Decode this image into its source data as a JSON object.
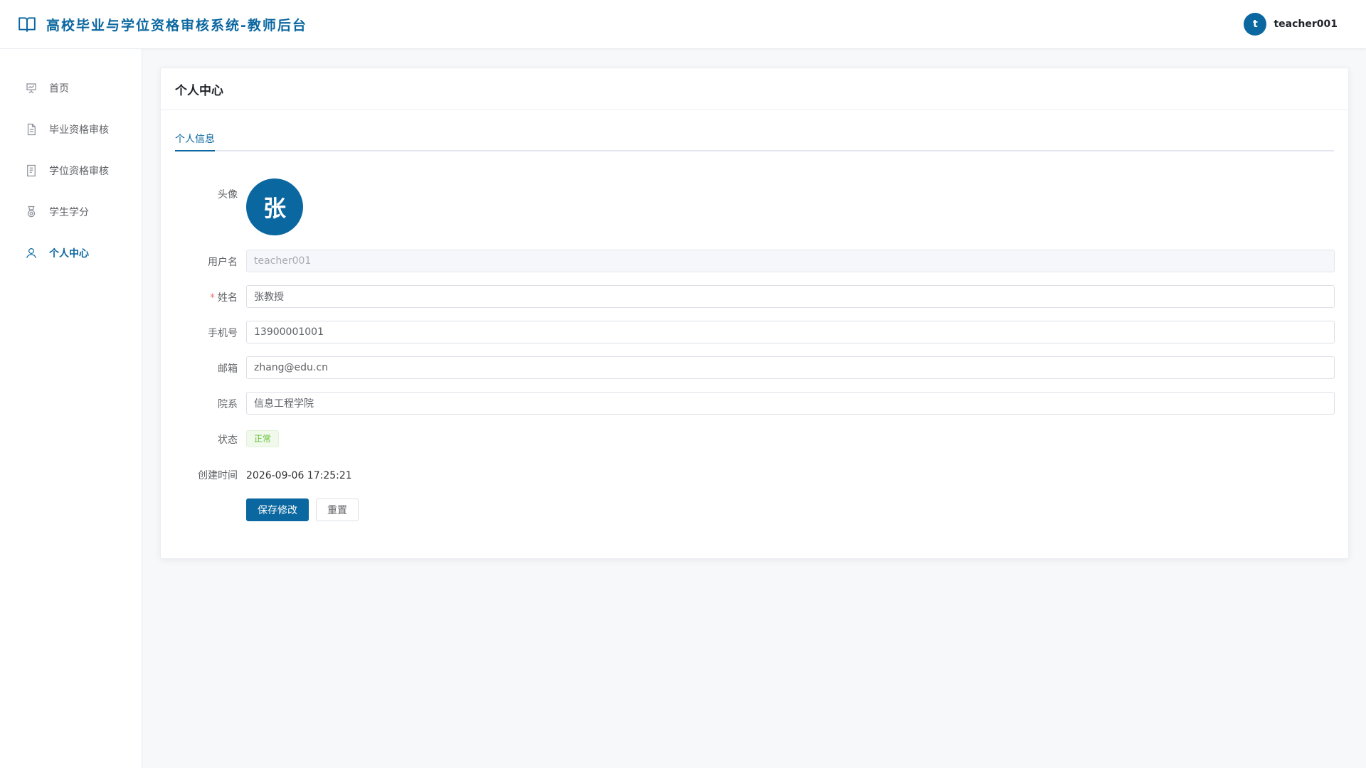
{
  "app": {
    "title": "高校毕业与学位资格审核系统-教师后台"
  },
  "user": {
    "avatar_letter": "t",
    "name": "teacher001"
  },
  "sidebar": {
    "items": [
      {
        "label": "首页",
        "icon": "dashboard-icon",
        "active": false
      },
      {
        "label": "毕业资格审核",
        "icon": "document-icon",
        "active": false
      },
      {
        "label": "学位资格审核",
        "icon": "document-list-icon",
        "active": false
      },
      {
        "label": "学生学分",
        "icon": "medal-icon",
        "active": false
      },
      {
        "label": "个人中心",
        "icon": "user-icon",
        "active": true
      }
    ]
  },
  "page": {
    "title": "个人中心",
    "tabs": [
      {
        "label": "个人信息",
        "active": true
      }
    ]
  },
  "form": {
    "avatar": {
      "label": "头像",
      "letter": "张"
    },
    "username": {
      "label": "用户名",
      "value": "teacher001",
      "disabled": true
    },
    "name": {
      "label": "姓名",
      "required_mark": "*",
      "value": "张教授"
    },
    "phone": {
      "label": "手机号",
      "value": "13900001001"
    },
    "email": {
      "label": "邮箱",
      "value": "zhang@edu.cn"
    },
    "department": {
      "label": "院系",
      "value": "信息工程学院"
    },
    "status": {
      "label": "状态",
      "value": "正常",
      "color": "#67c23a"
    },
    "created": {
      "label": "创建时间",
      "value": "2026-09-06 17:25:21"
    },
    "save_label": "保存修改",
    "reset_label": "重置"
  },
  "colors": {
    "primary": "#0b67a0",
    "success": "#67c23a",
    "danger": "#f56c6c"
  }
}
